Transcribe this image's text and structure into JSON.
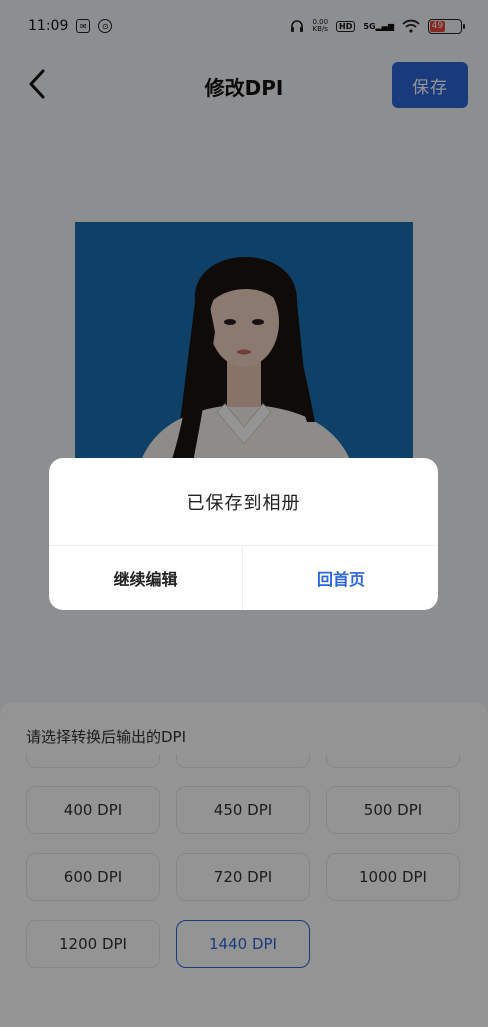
{
  "status_bar": {
    "time": "11:09",
    "net_speed_top": "0.00",
    "net_speed_bottom": "KB/s",
    "hd_label": "HD",
    "signal_label": "5G",
    "battery": "49"
  },
  "header": {
    "title": "修改DPI",
    "save_label": "保存"
  },
  "sheet": {
    "title": "请选择转换后输出的DPI",
    "dpi_options": [
      "400 DPI",
      "450 DPI",
      "500 DPI",
      "600 DPI",
      "720 DPI",
      "1000 DPI",
      "1200 DPI",
      "1440 DPI"
    ],
    "selected": "1440 DPI"
  },
  "dialog": {
    "message": "已保存到相册",
    "continue_label": "继续编辑",
    "home_label": "回首页"
  },
  "colors": {
    "accent": "#2b67d8",
    "photo_background": "#1a6fb3"
  }
}
